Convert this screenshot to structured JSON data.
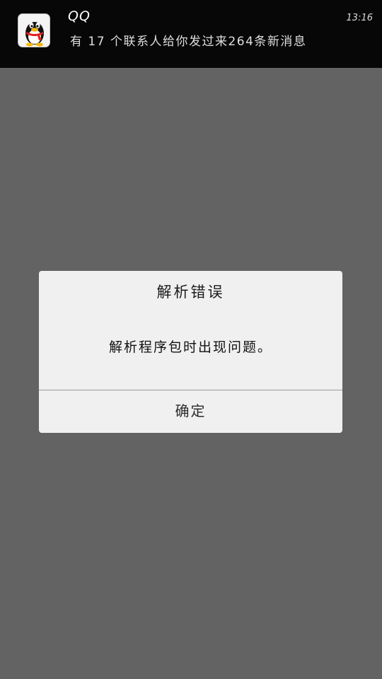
{
  "notification": {
    "app_name": "QQ",
    "time": "13:16",
    "message": "有 17 个联系人给你发过来264条新消息",
    "icon": "qq-penguin-icon"
  },
  "dialog": {
    "title": "解析错误",
    "message": "解析程序包时出现问题。",
    "confirm_label": "确定"
  },
  "colors": {
    "backdrop": "#636363",
    "notification_bg": "#070707",
    "dialog_bg": "#f0f0f0",
    "divider": "#9a9a9a"
  }
}
